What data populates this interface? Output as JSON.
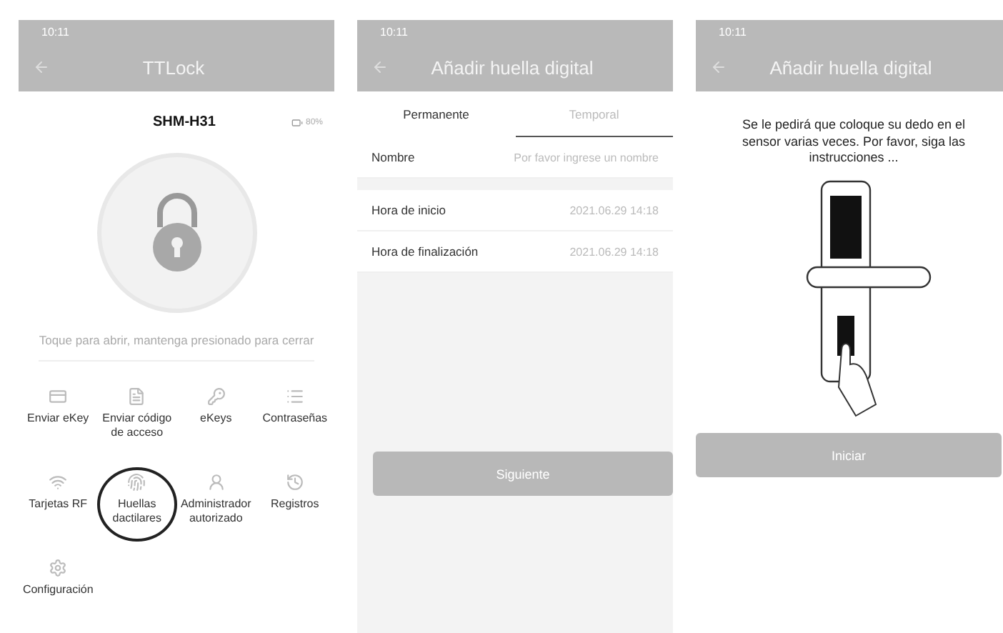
{
  "screens": [
    {
      "kind": "lock",
      "status_time": "10:11",
      "title": "TTLock",
      "lock_name": "SHM-H31",
      "battery": "80%",
      "hint": "Toque para abrir, mantenga presionado para cerrar",
      "actions": [
        {
          "label": "Enviar eKey",
          "circled": false
        },
        {
          "label": "Enviar código de acceso",
          "circled": false
        },
        {
          "label": "eKeys",
          "circled": false
        },
        {
          "label": "Contraseñas",
          "circled": false
        },
        {
          "label": "Tarjetas RF",
          "circled": false
        },
        {
          "label": "Huellas dactilares",
          "circled": true
        },
        {
          "label": "Administrador autorizado",
          "circled": false
        },
        {
          "label": "Registros",
          "circled": false
        },
        {
          "label": "Configuración",
          "circled": false
        }
      ]
    },
    {
      "kind": "form",
      "status_time": "10:11",
      "title": "Añadir huella digital",
      "tabs": [
        {
          "label": "Permanente",
          "selected": true,
          "underline": false
        },
        {
          "label": "Temporal",
          "selected": false,
          "underline": true
        }
      ],
      "name_field": {
        "label": "Nombre",
        "placeholder": "Por favor ingrese un nombre"
      },
      "times": [
        {
          "label": "Hora de inicio",
          "value": "2021.06.29 14:18"
        },
        {
          "label": "Hora de finalización",
          "value": "2021.06.29 14:18"
        }
      ],
      "button": {
        "label": "Siguiente",
        "disabled": true
      }
    },
    {
      "kind": "guide",
      "status_time": "10:11",
      "title": "Añadir huella digital",
      "message": "Se le pedirá que coloque su dedo en el sensor varias veces. Por favor, siga las instrucciones ...",
      "button": {
        "label": "Iniciar",
        "disabled": true
      }
    }
  ]
}
